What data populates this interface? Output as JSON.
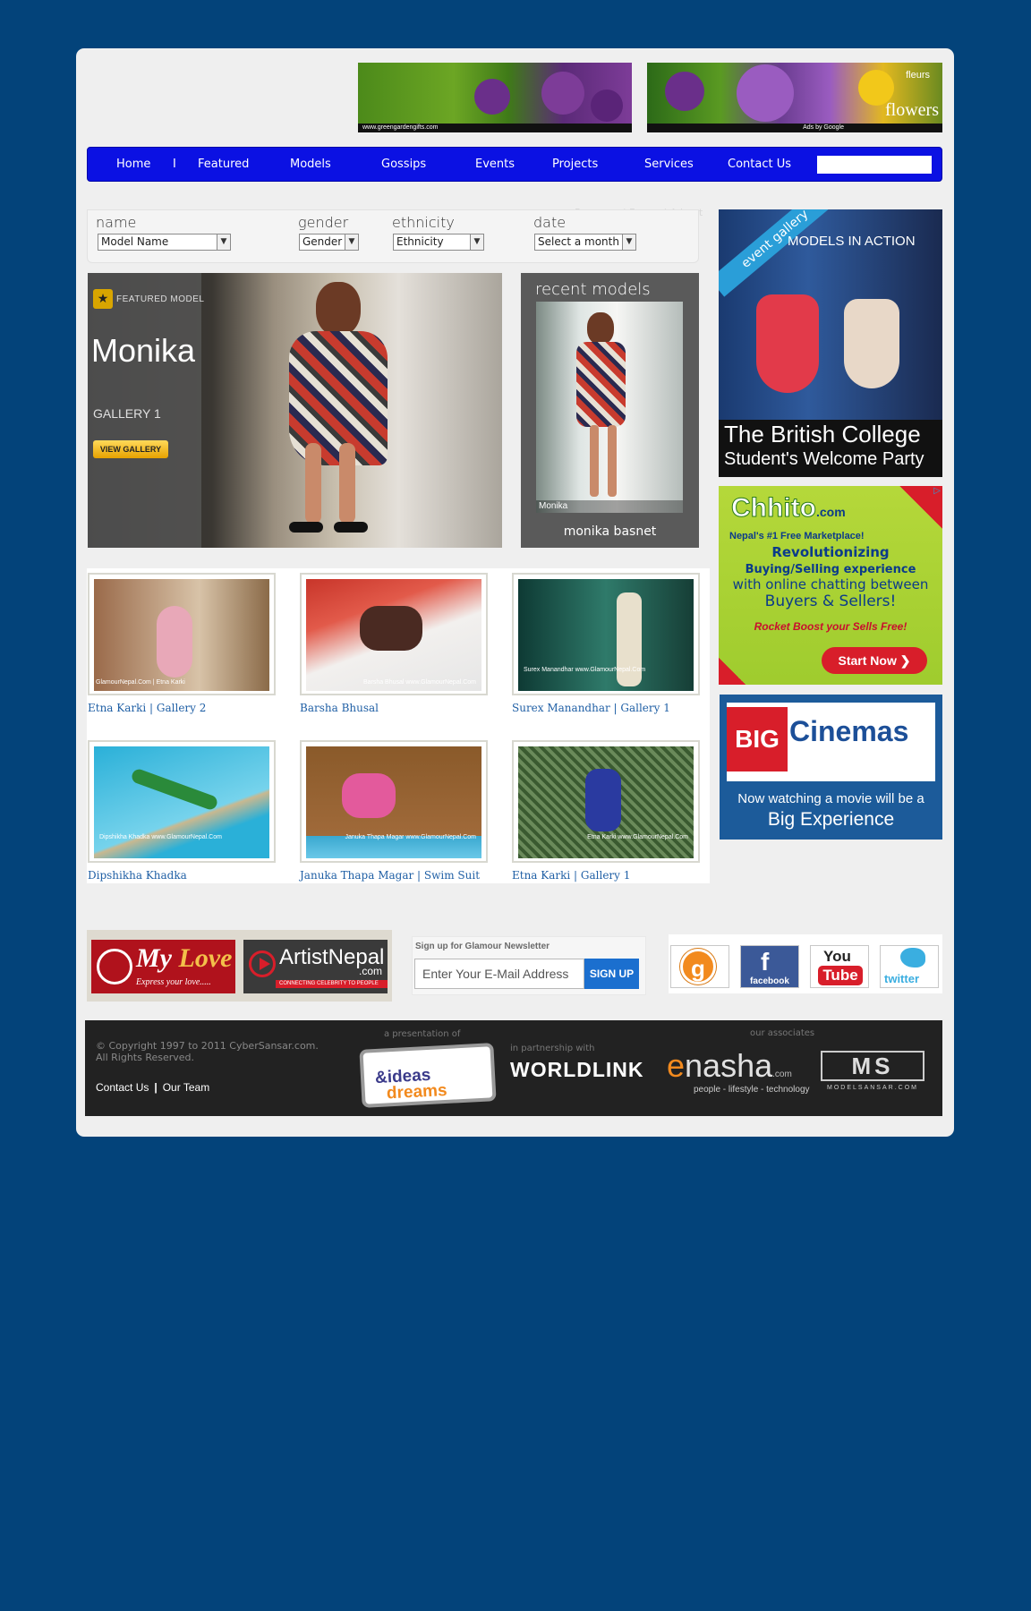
{
  "top_ads": {
    "ad1_url": "www.greengardengifts.com",
    "ad2_fleurs": "fleurs",
    "ad2_flowers": "flowers",
    "ad2_adsby": "Ads by Google"
  },
  "nav": {
    "items": [
      "Home",
      "Featured",
      "Models",
      "Gossips",
      "Events",
      "Projects",
      "Services",
      "Contact Us"
    ],
    "separator": "I",
    "search_placeholder": ""
  },
  "mini_links": "Resource | Forum | Advert",
  "filters": {
    "name_label": "name",
    "name_value": "Model Name",
    "gender_label": "gender",
    "gender_value": "Gender",
    "ethnicity_label": "ethnicity",
    "ethnicity_value": "Ethnicity",
    "date_label": "date",
    "date_value": "Select a month"
  },
  "featured": {
    "badge": "FEATURED MODEL",
    "name": "Monika",
    "gallery": "GALLERY 1",
    "button": "VIEW GALLERY"
  },
  "recent": {
    "title": "recent models",
    "photo_caption": "Monika",
    "name": "monika basnet"
  },
  "gallery": {
    "items": [
      {
        "caption": "Etna Karki | Gallery 2",
        "watermark": "GlamourNepal.Com | Etna Karki",
        "color_a": "#b57a5a",
        "color_b": "#d8c3a8"
      },
      {
        "caption": "Barsha Bhusal",
        "watermark": "Barsha Bhusal www.GlamourNepal.Com",
        "color_a": "#c8352a",
        "color_b": "#ecebe9"
      },
      {
        "caption": "Surex Manandhar | Gallery 1",
        "watermark": "Surex Manandhar www.GlamourNepal.Com",
        "color_a": "#10403a",
        "color_b": "#2f7a6a"
      },
      {
        "caption": "Dipshikha Khadka",
        "watermark": "Dipshikha Khadka www.GlamourNepal.Com",
        "color_a": "#2ab0d8",
        "color_b": "#76d3ec"
      },
      {
        "caption": "Januka Thapa Magar | Swim Suit",
        "watermark": "Januka Thapa Magar www.GlamourNepal.Com",
        "color_a": "#8a5a2a",
        "color_b": "#e35a9c"
      },
      {
        "caption": "Etna Karki | Gallery 1",
        "watermark": "Etna Karki www.GlamourNepal.Com",
        "color_a": "#3a5a30",
        "color_b": "#2a3aa0"
      }
    ]
  },
  "ad_british": {
    "ribbon": "event gallery",
    "headline": "MODELS IN ACTION",
    "line1": "The British College",
    "line2": "Student's Welcome Party"
  },
  "ad_chhito": {
    "logo": "Chhito",
    "logo_suffix": ".com",
    "tagline": "Nepal's #1 Free Marketplace!",
    "line1": "Revolutionizing",
    "line2": "Buying/Selling experience",
    "line3": "with online chatting between",
    "line4": "Buyers & Sellers!",
    "boost": "Rocket Boost your Sells Free!",
    "cta": "Start Now ❯"
  },
  "ad_bigcinemas": {
    "big": "BIG",
    "cinemas": "Cinemas",
    "line1": "Now watching a movie will be a",
    "line2": "Big Experience"
  },
  "partners": {
    "mylove_my": "My ",
    "mylove_love": "Love",
    "mylove_sub": "Express your love.....",
    "artist_name": "ArtistNepal",
    "artist_com": ".com",
    "artist_tag": "CONNECTING CELEBRITY TO PEOPLE"
  },
  "newsletter": {
    "heading": "Sign up for Glamour Newsletter",
    "placeholder": "Enter Your E-Mail Address",
    "button": "SIGN UP"
  },
  "social": {
    "blog": "g",
    "facebook_f": "f",
    "facebook": "facebook",
    "you": "You",
    "tube": "Tube",
    "twitter": "twitter"
  },
  "footer": {
    "copyright1": "© Copyright 1997 to 2011 CyberSansar.com.",
    "copyright2": "All Rights Reserved.",
    "contact": "Contact Us",
    "separator": "|",
    "team": "Our Team",
    "presentation": "a presentation of",
    "dni_a": "dreams",
    "dni_b": "&ideas",
    "partnership": "in partnership with",
    "worldlink": "WORLDLINK",
    "associates": "our associates",
    "enasha_e": "e",
    "enasha": "nasha",
    "enasha_com": ".com",
    "enasha_sub": "people - lifestyle - technology",
    "ms": "MS",
    "ms_sub": "MODELSANSAR.COM"
  }
}
